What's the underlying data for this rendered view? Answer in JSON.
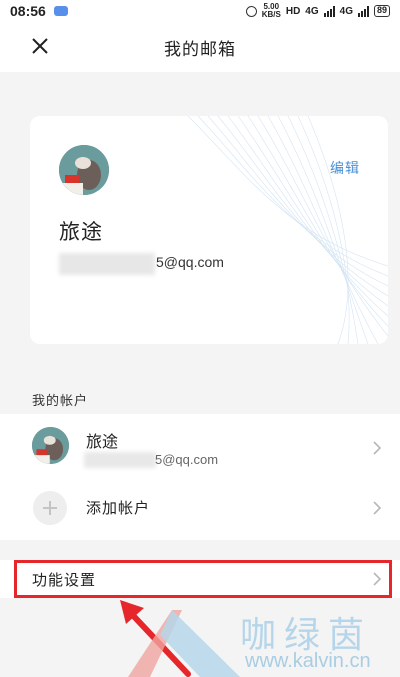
{
  "status_bar": {
    "time": "08:56",
    "speed_value": "5.00",
    "speed_unit": "KB/S",
    "hd": "HD",
    "net1": "4G",
    "net2": "4G",
    "battery": "89"
  },
  "header": {
    "title": "我的邮箱"
  },
  "profile_card": {
    "edit_label": "编辑",
    "name": "旅途",
    "email_visible": "5@qq.com"
  },
  "accounts_section": {
    "label": "我的帐户",
    "items": [
      {
        "name": "旅途",
        "email_visible": "5@qq.com"
      }
    ],
    "add_label": "添加帐户"
  },
  "settings_row": {
    "label": "功能设置",
    "highlight_color": "#e5262b"
  },
  "watermark": {
    "text": "咖绿茵",
    "url": "www.kalvin.cn"
  },
  "colors": {
    "accent": "#4a8fd8",
    "background": "#f4f4f4"
  }
}
